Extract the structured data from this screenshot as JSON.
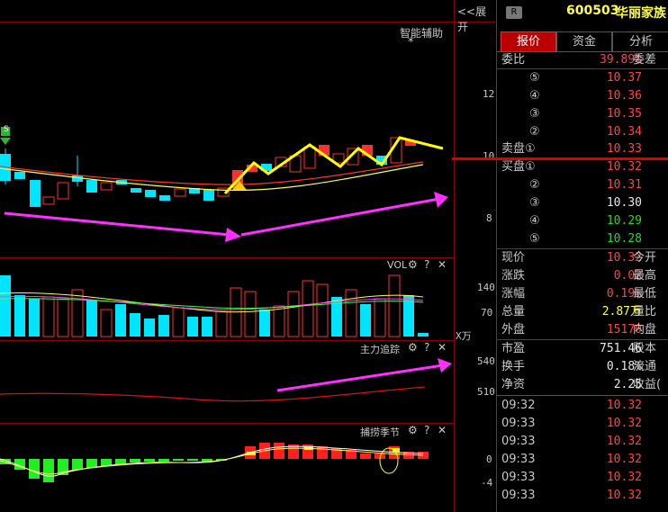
{
  "header": {
    "collapse_label": "<<展开",
    "r_badge": "R",
    "stock_code": "600503",
    "stock_name": "华丽家族"
  },
  "main_chart": {
    "smart_assist_label": "智能辅助",
    "star_mark": "*",
    "y_ticks": [
      "12",
      "10",
      "8"
    ],
    "signal_mark": "S"
  },
  "vol_panel": {
    "title": "VOL",
    "y_ticks": [
      "140",
      "70"
    ],
    "unit": "X万"
  },
  "main_force_panel": {
    "title": "主力追踪",
    "y_ticks": [
      "540",
      "510"
    ]
  },
  "season_panel": {
    "title": "捕捞季节",
    "y_ticks": [
      "0",
      "-4"
    ]
  },
  "panel_controls": {
    "gear": "⚙",
    "help": "?",
    "close": "✕"
  },
  "tabs": [
    "报价",
    "资金",
    "分析"
  ],
  "order_book": {
    "ratio_label": "委比",
    "ratio_value": "39.89%",
    "diff_label": "委差",
    "sell": [
      {
        "label": "⑤",
        "price": "10.37"
      },
      {
        "label": "④",
        "price": "10.36"
      },
      {
        "label": "③",
        "price": "10.35"
      },
      {
        "label": "②",
        "price": "10.34"
      },
      {
        "label": "卖盘①",
        "price": "10.33"
      }
    ],
    "buy": [
      {
        "label": "买盘①",
        "price": "10.32",
        "color": "red"
      },
      {
        "label": "②",
        "price": "10.31",
        "color": "red"
      },
      {
        "label": "③",
        "price": "10.30",
        "color": "white"
      },
      {
        "label": "④",
        "price": "10.29",
        "color": "green"
      },
      {
        "label": "⑤",
        "price": "10.28",
        "color": "green"
      }
    ]
  },
  "quote": [
    {
      "label": "现价",
      "value": "10.32",
      "label2": "今开",
      "color": "red"
    },
    {
      "label": "涨跌",
      "value": "0.02",
      "label2": "最高",
      "color": "red"
    },
    {
      "label": "涨幅",
      "value": "0.19%",
      "label2": "最低",
      "color": "red"
    },
    {
      "label": "总量",
      "value": "2.87万",
      "label2": "量比",
      "color": "yellow"
    },
    {
      "label": "外盘",
      "value": "15170",
      "label2": "内盘",
      "color": "red"
    }
  ],
  "fundamentals": [
    {
      "label": "市盈",
      "value": "751.46",
      "label2": "股本"
    },
    {
      "label": "换手",
      "value": "0.18%",
      "label2": "流通"
    },
    {
      "label": "净资",
      "value": "2.25",
      "label2": "收益(",
      "value_suffix": ""
    }
  ],
  "ticks": [
    {
      "time": "09:32",
      "price": "10.32"
    },
    {
      "time": "09:33",
      "price": "10.32"
    },
    {
      "time": "09:33",
      "price": "10.32"
    },
    {
      "time": "09:33",
      "price": "10.32"
    },
    {
      "time": "09:33",
      "price": "10.32"
    },
    {
      "time": "09:33",
      "price": "10.32"
    }
  ],
  "colors": {
    "up": "#ff3030",
    "down": "#00e5ff",
    "bg": "#000000",
    "accent_red": "#dd0000"
  }
}
